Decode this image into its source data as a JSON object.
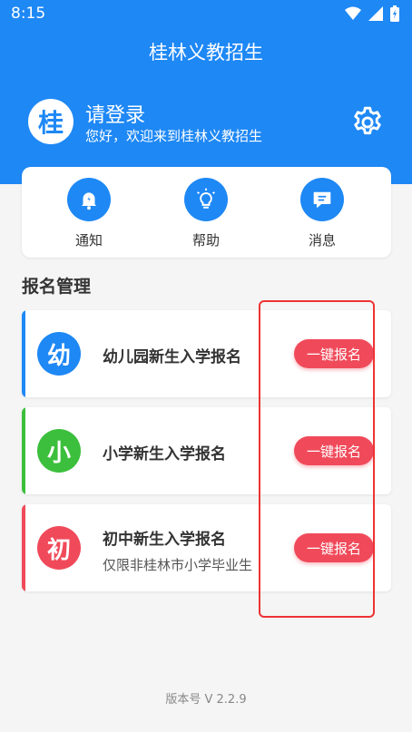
{
  "status_bar": {
    "time": "8:15",
    "icons": [
      "wifi-icon",
      "signal-icon",
      "battery-icon"
    ]
  },
  "app_title": "桂林义教招生",
  "profile": {
    "avatar_char": "桂",
    "name": "请登录",
    "welcome": "您好，欢迎来到桂林义教招生"
  },
  "quick_actions": [
    {
      "label": "通知",
      "icon": "bell-icon"
    },
    {
      "label": "帮助",
      "icon": "lightbulb-icon"
    },
    {
      "label": "消息",
      "icon": "message-icon"
    }
  ],
  "section_title": "报名管理",
  "enroll_items": [
    {
      "char": "幼",
      "title": "幼儿园新生入学报名",
      "subtitle": "",
      "button": "一键报名",
      "color": "#1e88f5"
    },
    {
      "char": "小",
      "title": "小学新生入学报名",
      "subtitle": "",
      "button": "一键报名",
      "color": "#3cbf3c"
    },
    {
      "char": "初",
      "title": "初中新生入学报名",
      "subtitle": "仅限非桂林市小学毕业生",
      "button": "一键报名",
      "color": "#f04a5a"
    }
  ],
  "version": "版本号 V 2.2.9",
  "colors": {
    "primary": "#1e88f5",
    "accent_red": "#f04a5a",
    "green": "#3cbf3c",
    "highlight": "#e33333"
  }
}
